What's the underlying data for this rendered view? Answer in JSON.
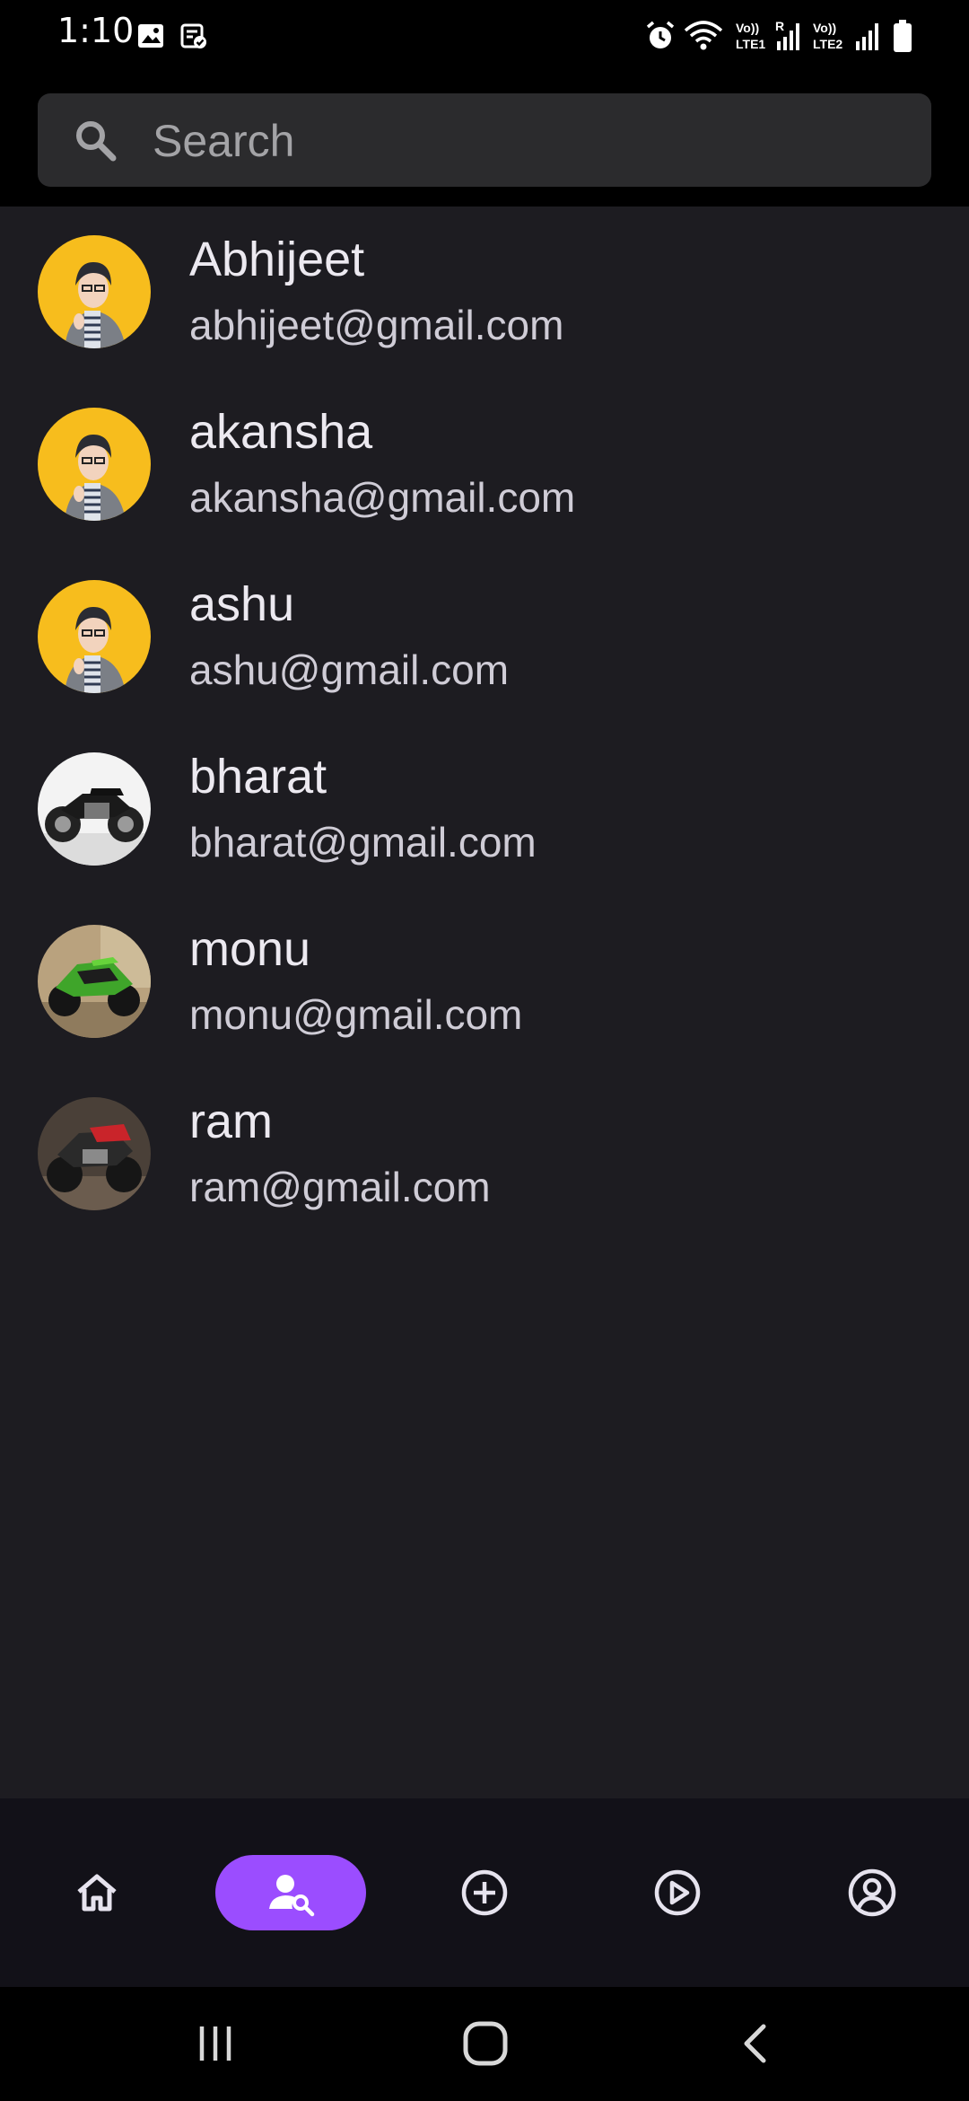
{
  "status_bar": {
    "time": "1:10",
    "icons": [
      "gallery-icon",
      "task-icon",
      "alarm-icon",
      "wifi-icon",
      "lte1-signal-icon",
      "lte2-signal-icon",
      "battery-icon"
    ],
    "lte1_label": "Vo)) LTE1",
    "lte2_label": "Vo)) LTE2",
    "roaming": "R"
  },
  "search": {
    "placeholder": "Search",
    "value": ""
  },
  "users": [
    {
      "name": "Abhijeet",
      "email": "abhijeet@gmail.com",
      "avatar": "anime-character-avatar"
    },
    {
      "name": "akansha",
      "email": "akansha@gmail.com",
      "avatar": "anime-character-avatar"
    },
    {
      "name": "ashu",
      "email": "ashu@gmail.com",
      "avatar": "anime-character-avatar"
    },
    {
      "name": "bharat",
      "email": "bharat@gmail.com",
      "avatar": "black-motorcycle-photo"
    },
    {
      "name": "monu",
      "email": "monu@gmail.com",
      "avatar": "green-motorcycle-photo"
    },
    {
      "name": "ram",
      "email": "ram@gmail.com",
      "avatar": "red-motorcycle-photo"
    }
  ],
  "bottom_nav": {
    "items": [
      "home-icon",
      "user-search-icon",
      "add-circle-icon",
      "play-circle-icon",
      "account-circle-icon"
    ],
    "active": "user-search-icon"
  },
  "system_nav": {
    "items": [
      "recent-apps-icon",
      "home-button-icon",
      "back-icon"
    ]
  },
  "colors": {
    "accent": "#9b4dff",
    "list_background": "#1d1c21",
    "search_background": "#2b2b2d",
    "nav_background": "#121118"
  }
}
